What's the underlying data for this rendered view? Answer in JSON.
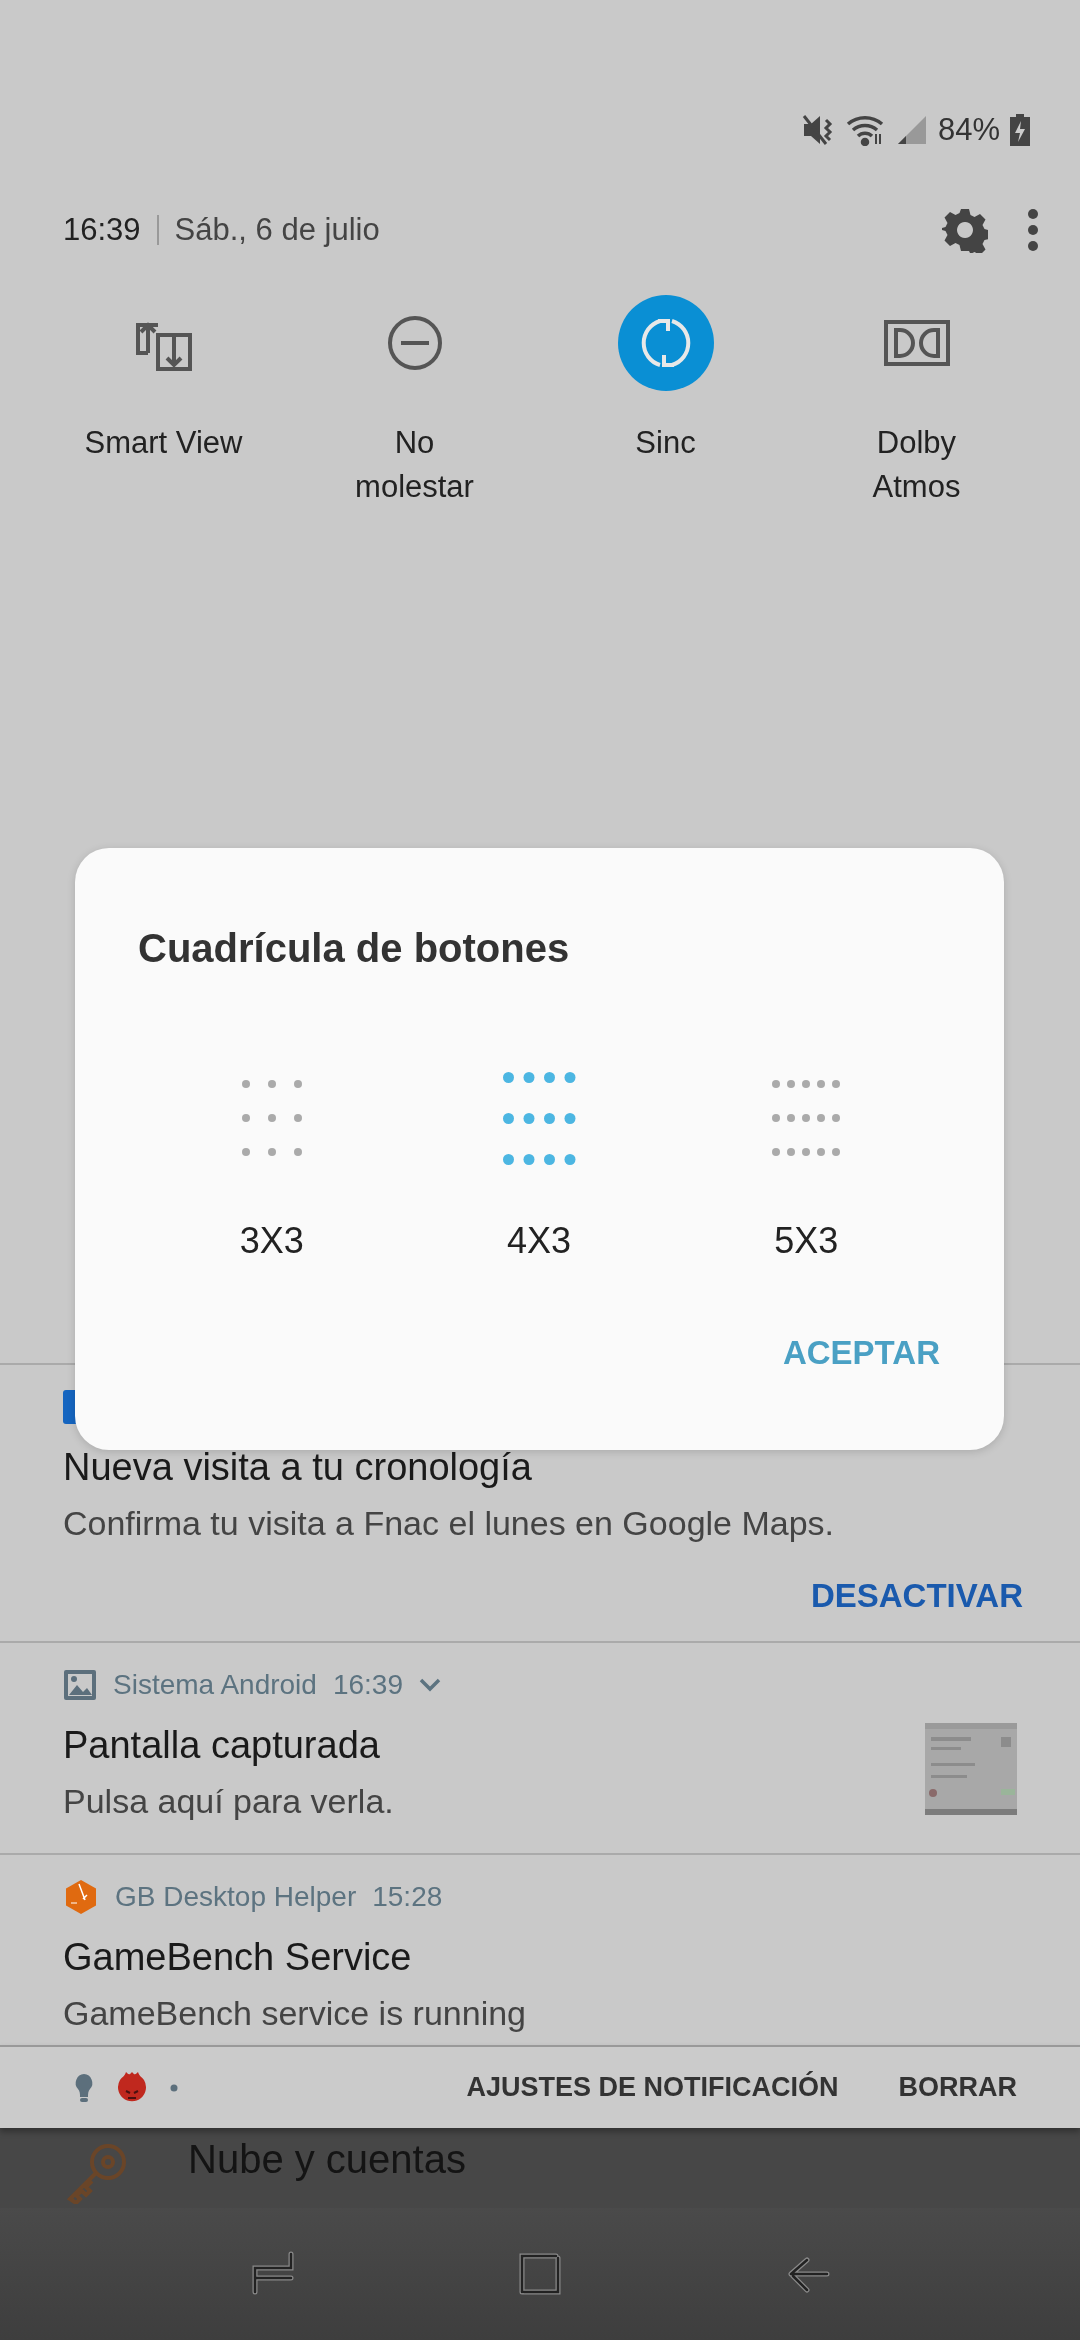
{
  "status_bar": {
    "battery": "84%"
  },
  "header": {
    "time": "16:39",
    "date": "Sáb., 6 de julio"
  },
  "quick_tiles": [
    {
      "label": "Smart View",
      "kind": "smart-view",
      "on": false
    },
    {
      "label": "No\nmolestar",
      "kind": "dnd",
      "on": false
    },
    {
      "label": "Sinc",
      "kind": "sync",
      "on": true
    },
    {
      "label": "Dolby\nAtmos",
      "kind": "dolby",
      "on": false
    }
  ],
  "notifications": [
    {
      "kind": "maps",
      "title": "Nueva visita a tu cronología",
      "text": "Confirma tu visita a Fnac el lunes en Google Maps.",
      "action": "DESACTIVAR"
    },
    {
      "kind": "screenshot",
      "app": "Sistema Android",
      "time": "16:39",
      "title": "Pantalla capturada",
      "text": "Pulsa aquí para verla."
    },
    {
      "kind": "gamebench",
      "app": "GB Desktop Helper",
      "time": "15:28",
      "title": "GameBench Service",
      "text": "GameBench service is running"
    }
  ],
  "footer": {
    "actions": [
      "AJUSTES DE NOTIFICACIÓN",
      "BORRAR"
    ]
  },
  "background_app": {
    "title": "Nube y cuentas"
  },
  "dialog": {
    "title": "Cuadrícula de botones",
    "options": [
      {
        "label": "3X3",
        "selected": false
      },
      {
        "label": "4X3",
        "selected": true
      },
      {
        "label": "5X3",
        "selected": false
      }
    ],
    "button": "ACEPTAR"
  }
}
